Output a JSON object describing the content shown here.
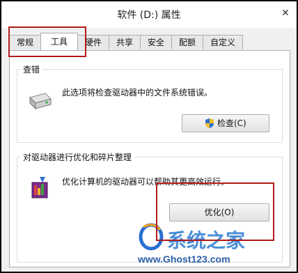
{
  "window": {
    "title": "软件 (D:) 属性"
  },
  "tabs": [
    "常规",
    "工具",
    "硬件",
    "共享",
    "安全",
    "配额",
    "自定义"
  ],
  "active_tab": "工具",
  "check_group": {
    "label": "查错",
    "description": "此选项将检查驱动器中的文件系统错误。",
    "button_label": "检查(C)"
  },
  "optimize_group": {
    "label": "对驱动器进行优化和碎片整理",
    "description": "优化计算机的驱动器可以帮助其更高效运行。",
    "button_label": "优化(O)"
  },
  "watermark": {
    "brand": "系统之家",
    "url": "www.Ghost123.com"
  },
  "colors": {
    "highlight": "#b01a1a",
    "shield_blue": "#2f6fcf",
    "shield_yellow": "#f2c01e"
  }
}
